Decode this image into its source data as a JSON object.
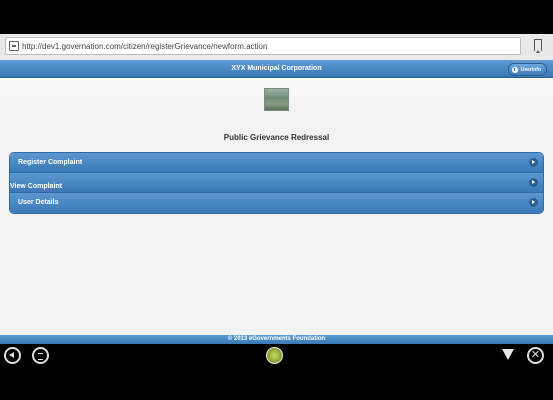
{
  "browser": {
    "url": "http://dev1.governation.com/citizen/registerGrievance/newform.action"
  },
  "header": {
    "title": "XYX Municipal Corporation",
    "user_info_label": "UserInfo"
  },
  "main": {
    "page_title": "Public Grievance Redressal",
    "menu": [
      {
        "label": "Register Complaint"
      },
      {
        "label": "View Complaint"
      },
      {
        "label": "User Details"
      }
    ]
  },
  "footer": {
    "text": "© 2013 eGovernments Foundation"
  },
  "icons": {
    "address": "page-icon",
    "bookmark": "bookmark-icon",
    "user_info": "info-icon",
    "menu_chevron": "chevron-right-icon",
    "nav_back": "back-icon",
    "nav_menu": "menu-icon",
    "nav_home": "home-icon",
    "nav_apps": "apps-icon",
    "nav_close": "close-icon"
  },
  "colors": {
    "header_blue": "#3a78b6",
    "accent_blue": "#5b98d1",
    "page_bg": "#f3f3f3"
  }
}
